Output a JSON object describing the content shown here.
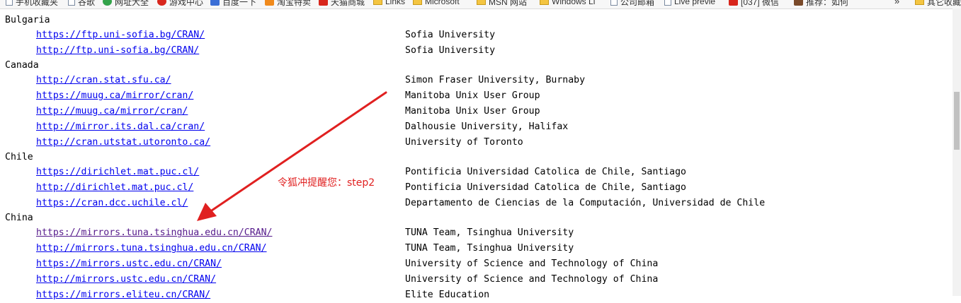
{
  "bookmarks": [
    {
      "label": "手机收藏夹",
      "icon": "page-icon"
    },
    {
      "label": "谷歌",
      "icon": "page-icon"
    },
    {
      "label": "网址大全",
      "icon": "green-globe-icon"
    },
    {
      "label": "游戏中心",
      "icon": "game-icon"
    },
    {
      "label": "百度一下",
      "icon": "baidu-paw-icon"
    },
    {
      "label": "淘宝特卖",
      "icon": "taobao-icon"
    },
    {
      "label": "天猫商城",
      "icon": "tmall-icon"
    },
    {
      "label": "Links",
      "icon": "folder-icon"
    },
    {
      "label": "Microsoft",
      "icon": "folder-icon"
    },
    {
      "label": "MSN 网站",
      "icon": "folder-icon"
    },
    {
      "label": "Windows Li",
      "icon": "folder-icon"
    },
    {
      "label": "公司邮箱",
      "icon": "page-icon"
    },
    {
      "label": "Live previe",
      "icon": "page-icon"
    },
    {
      "label": "[037] 微信",
      "icon": "red-c-icon"
    },
    {
      "label": "推荐：如何",
      "icon": "avatar-icon"
    },
    {
      "label": "其它收藏",
      "icon": "folder-icon"
    }
  ],
  "bookmarks_more": "»",
  "mirrors": {
    "bulgaria": {
      "country": "Bulgaria",
      "rows": [
        {
          "url": "https://ftp.uni-sofia.bg/CRAN/",
          "host": "Sofia University"
        },
        {
          "url": "http://ftp.uni-sofia.bg/CRAN/",
          "host": "Sofia University"
        }
      ]
    },
    "canada": {
      "country": "Canada",
      "rows": [
        {
          "url": "http://cran.stat.sfu.ca/",
          "host": "Simon Fraser University, Burnaby"
        },
        {
          "url": "https://muug.ca/mirror/cran/",
          "host": "Manitoba Unix User Group"
        },
        {
          "url": "http://muug.ca/mirror/cran/",
          "host": "Manitoba Unix User Group"
        },
        {
          "url": "http://mirror.its.dal.ca/cran/",
          "host": "Dalhousie University, Halifax"
        },
        {
          "url": "http://cran.utstat.utoronto.ca/",
          "host": "University of Toronto"
        }
      ]
    },
    "chile": {
      "country": "Chile",
      "rows": [
        {
          "url": "https://dirichlet.mat.puc.cl/",
          "host": "Pontificia Universidad Catolica de Chile, Santiago"
        },
        {
          "url": "http://dirichlet.mat.puc.cl/",
          "host": "Pontificia Universidad Catolica de Chile, Santiago"
        },
        {
          "url": "https://cran.dcc.uchile.cl/",
          "host": "Departamento de Ciencias de la Computación, Universidad de Chile"
        }
      ]
    },
    "china": {
      "country": "China",
      "rows": [
        {
          "url": "https://mirrors.tuna.tsinghua.edu.cn/CRAN/",
          "host": "TUNA Team, Tsinghua University",
          "visited": true
        },
        {
          "url": "http://mirrors.tuna.tsinghua.edu.cn/CRAN/",
          "host": "TUNA Team, Tsinghua University"
        },
        {
          "url": "https://mirrors.ustc.edu.cn/CRAN/",
          "host": "University of Science and Technology of China"
        },
        {
          "url": "http://mirrors.ustc.edu.cn/CRAN/",
          "host": "University of Science and Technology of China"
        },
        {
          "url": "https://mirrors.eliteu.cn/CRAN/",
          "host": "Elite Education"
        }
      ]
    }
  },
  "annotation": {
    "text": "令狐冲提醒您：step2",
    "color": "#e02020"
  },
  "colors": {
    "link": "#0000ee",
    "visited_link": "#551a8b"
  }
}
